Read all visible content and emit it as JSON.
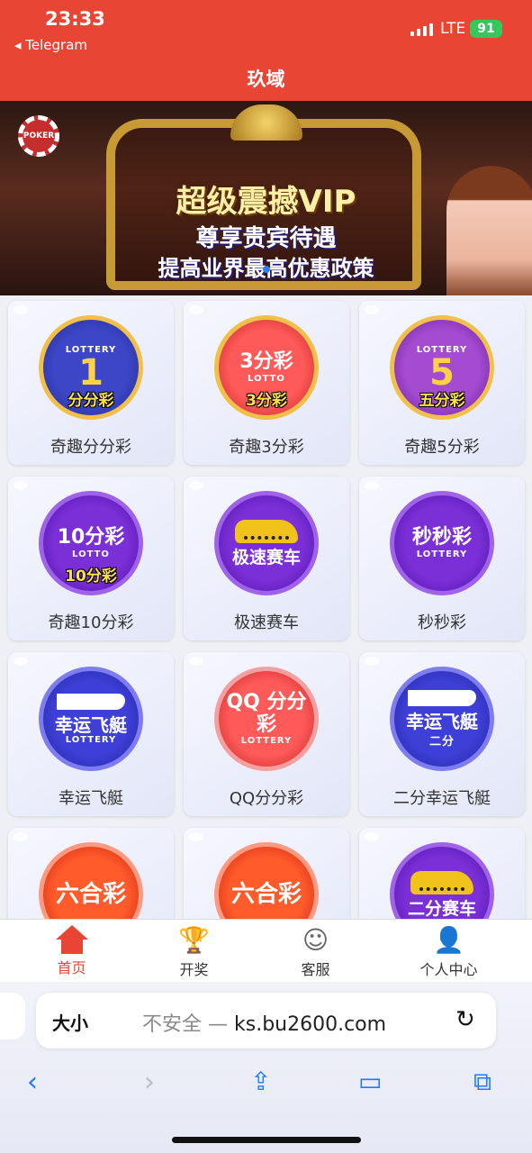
{
  "status_bar": {
    "time": "23:33",
    "back_app": "◂ Telegram",
    "network": "LTE",
    "battery": "91"
  },
  "header": {
    "title": "玖域"
  },
  "banner": {
    "line1": "超级震撼VIP",
    "line2": "尊享贵宾待遇",
    "line3": "提高业界最高优惠政策",
    "logo_text": "POKER"
  },
  "games": [
    {
      "label": "奇趣分分彩",
      "badge_main": "1",
      "badge_sub": "LOTTERY",
      "stamp": "分分彩"
    },
    {
      "label": "奇趣3分彩",
      "badge_main": "3分彩",
      "badge_sub": "LOTTO",
      "stamp": "3分彩"
    },
    {
      "label": "奇趣5分彩",
      "badge_main": "5",
      "badge_sub": "LOTTERY",
      "stamp": "五分彩"
    },
    {
      "label": "奇趣10分彩",
      "badge_main": "10分彩",
      "badge_sub": "LOTTO",
      "stamp": "10分彩"
    },
    {
      "label": "极速赛车",
      "badge_main": "极速赛车",
      "badge_sub": ""
    },
    {
      "label": "秒秒彩",
      "badge_main": "秒秒彩",
      "badge_sub": "LOTTERY"
    },
    {
      "label": "幸运飞艇",
      "badge_main": "幸运飞艇",
      "badge_sub": "LOTTERY"
    },
    {
      "label": "QQ分分彩",
      "badge_main": "QQ 分分彩",
      "badge_sub": "LOTTERY"
    },
    {
      "label": "二分幸运飞艇",
      "badge_main": "幸运飞艇",
      "badge_sub": "二分"
    },
    {
      "label": "",
      "badge_main": "六合彩",
      "badge_sub": ""
    },
    {
      "label": "",
      "badge_main": "六合彩",
      "badge_sub": ""
    },
    {
      "label": "",
      "badge_main": "二分赛车",
      "badge_sub": ""
    }
  ],
  "tabbar": {
    "items": [
      {
        "label": "首页",
        "icon": "home-icon",
        "active": true
      },
      {
        "label": "开奖",
        "icon": "trophy-icon",
        "active": false
      },
      {
        "label": "客服",
        "icon": "headset-icon",
        "active": false
      },
      {
        "label": "个人中心",
        "icon": "person-icon",
        "active": false
      }
    ]
  },
  "browser": {
    "text_size_label": "大小",
    "insecure_label": "不安全 —",
    "domain": "ks.bu2600.com"
  },
  "colors": {
    "brand_red": "#e84535",
    "ios_blue": "#1a7cff"
  }
}
